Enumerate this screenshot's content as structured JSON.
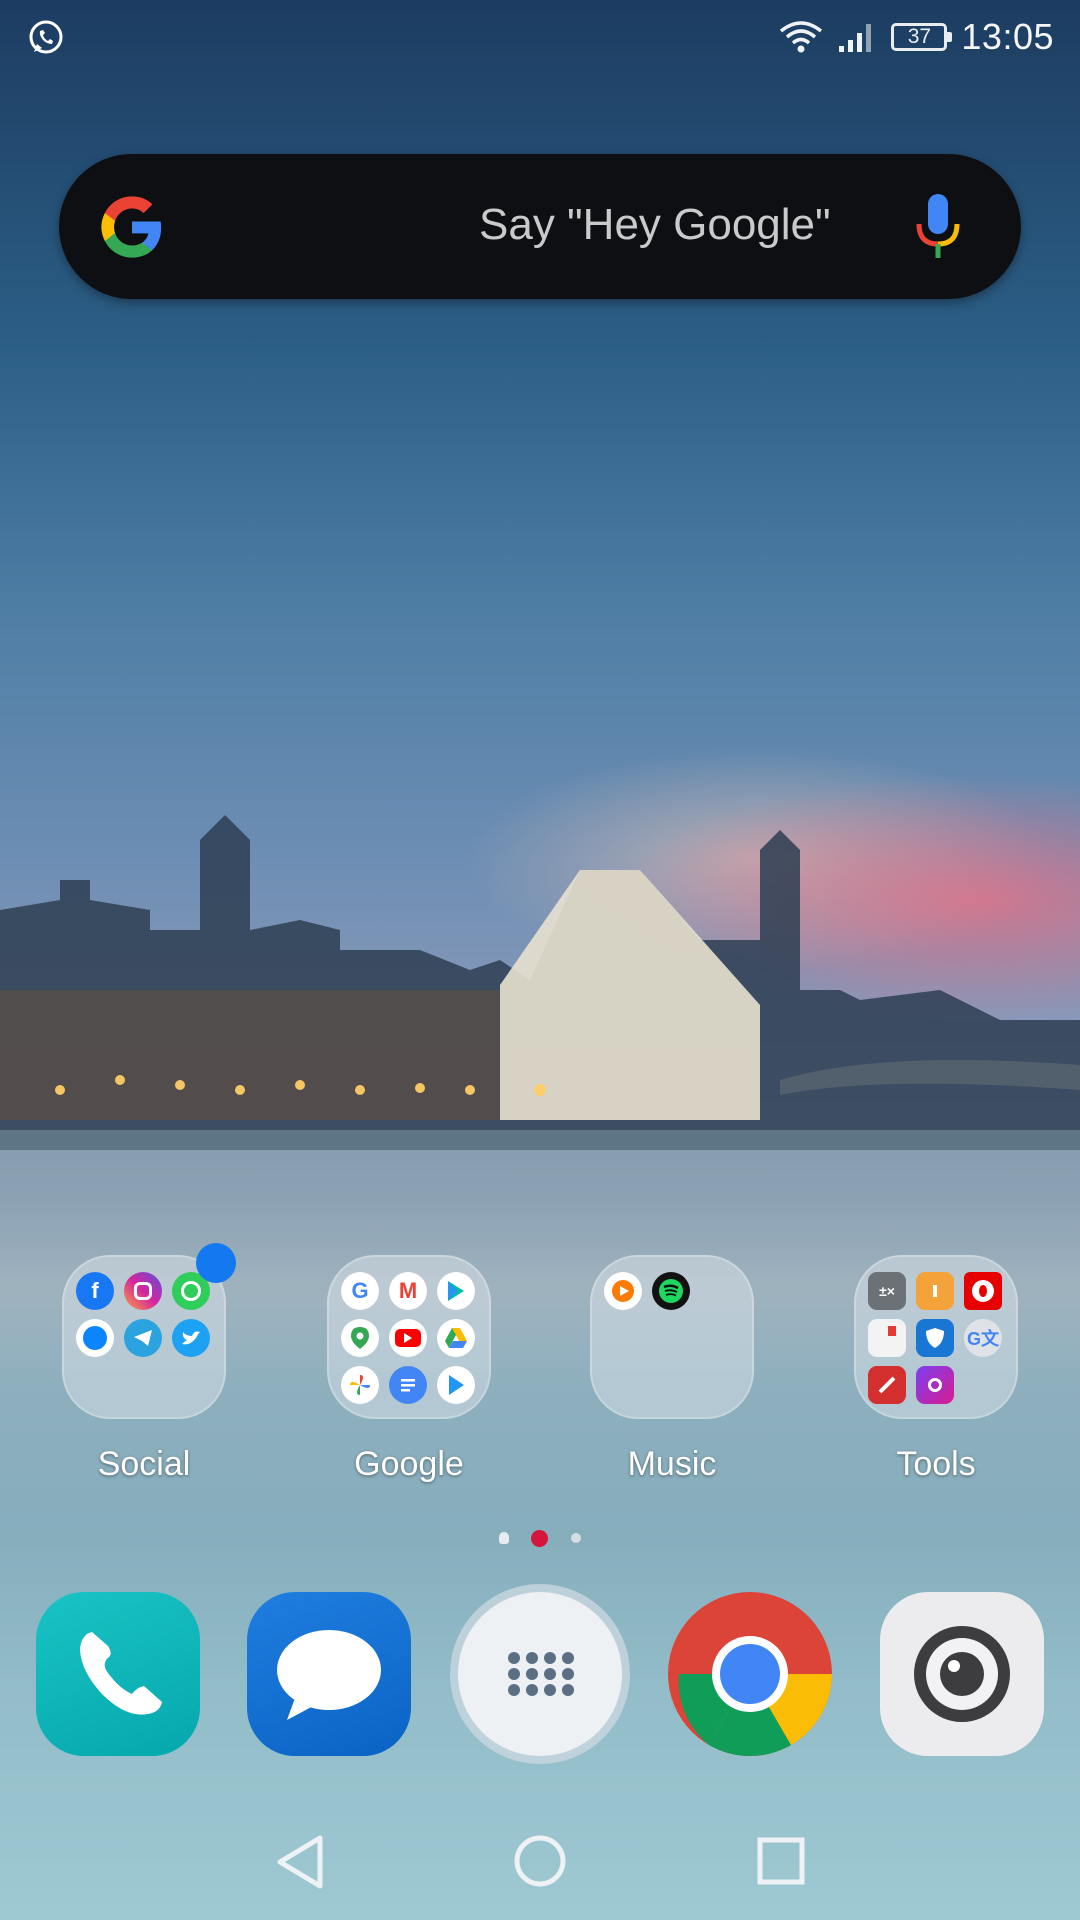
{
  "status_bar": {
    "notification_icon": "whatsapp-icon",
    "battery_level": "37",
    "time": "13:05"
  },
  "search_bar": {
    "hint": "Say \"Hey Google\"",
    "logo": "google-g-icon",
    "mic": "mic-icon"
  },
  "folders": [
    {
      "label": "Social",
      "apps": [
        "facebook",
        "instagram",
        "whatsapp",
        "messenger",
        "telegram",
        "twitter"
      ],
      "has_badge": true
    },
    {
      "label": "Google",
      "apps": [
        "google",
        "gmail",
        "play-store",
        "maps",
        "youtube",
        "drive",
        "photos",
        "docs",
        "play-movies"
      ]
    },
    {
      "label": "Music",
      "apps": [
        "play-music",
        "spotify"
      ]
    },
    {
      "label": "Tools",
      "apps": [
        "calculator",
        "files",
        "vodafone",
        "notes",
        "security",
        "translate",
        "lastpass",
        "picsart"
      ]
    }
  ],
  "page_indicator": {
    "pages": 3,
    "current": 2
  },
  "dock": [
    {
      "name": "phone",
      "icon": "phone-icon"
    },
    {
      "name": "messages",
      "icon": "message-icon"
    },
    {
      "name": "app-drawer",
      "icon": "apps-grid-icon"
    },
    {
      "name": "chrome",
      "icon": "chrome-icon"
    },
    {
      "name": "camera",
      "icon": "camera-icon"
    }
  ],
  "nav": [
    "back",
    "home",
    "recents"
  ]
}
